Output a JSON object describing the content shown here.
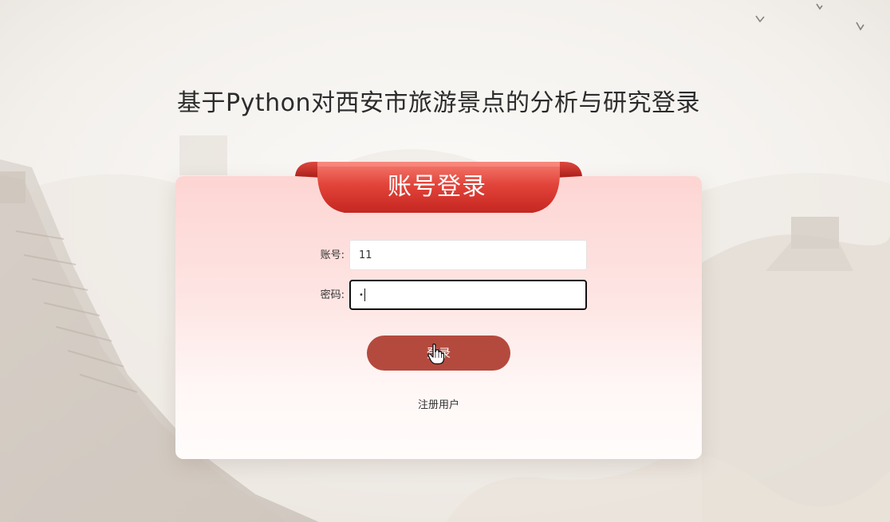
{
  "page": {
    "title": "基于Python对西安市旅游景点的分析与研究登录"
  },
  "login_card": {
    "ribbon_title": "账号登录",
    "account": {
      "label": "账号:",
      "value": "11"
    },
    "password": {
      "label": "密码:",
      "masked_value": "•"
    },
    "login_button": "登录",
    "register_link": "注册用户"
  },
  "colors": {
    "ribbon_red": "#d9342c",
    "button_red": "#b44a3e",
    "card_pink": "#fdd5d3"
  },
  "icons": {
    "cursor": "hand-pointer-icon",
    "background": "great-wall-scenery"
  }
}
